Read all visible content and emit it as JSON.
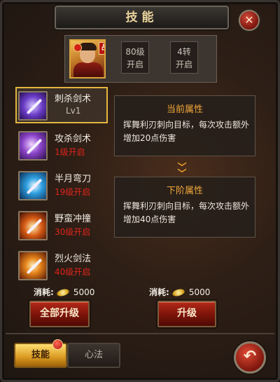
{
  "title": "技能",
  "close_icon": "close-icon",
  "hero": {
    "badge": "战",
    "requirements": [
      {
        "line1": "80级",
        "line2": "开启"
      },
      {
        "line1": "4转",
        "line2": "开启"
      }
    ]
  },
  "skills": [
    {
      "name": "刺杀剑术",
      "status": "Lv1",
      "selected": true
    },
    {
      "name": "攻杀剑术",
      "status": "1级开启",
      "selected": false
    },
    {
      "name": "半月弯刀",
      "status": "19级开启",
      "selected": false
    },
    {
      "name": "野蛮冲撞",
      "status": "30级开启",
      "selected": false
    },
    {
      "name": "烈火剑法",
      "status": "40级开启",
      "selected": false
    }
  ],
  "current": {
    "title": "当前属性",
    "desc": "挥舞利刃刺向目标，每次攻击额外增加20点伤害"
  },
  "next": {
    "title": "下阶属性",
    "desc": "挥舞利刃刺向目标，每次攻击额外增加40点伤害"
  },
  "cost_left": {
    "label": "消耗:",
    "amount": "5000"
  },
  "cost_right": {
    "label": "消耗:",
    "amount": "5000"
  },
  "buttons": {
    "upgrade_all": "全部升级",
    "upgrade": "升级"
  },
  "tabs": {
    "skill": "技能",
    "mental": "心法"
  },
  "colors": {
    "accent_gold": "#e3b640",
    "locked_red": "#e0241a",
    "title_orange": "#f2a83a"
  }
}
